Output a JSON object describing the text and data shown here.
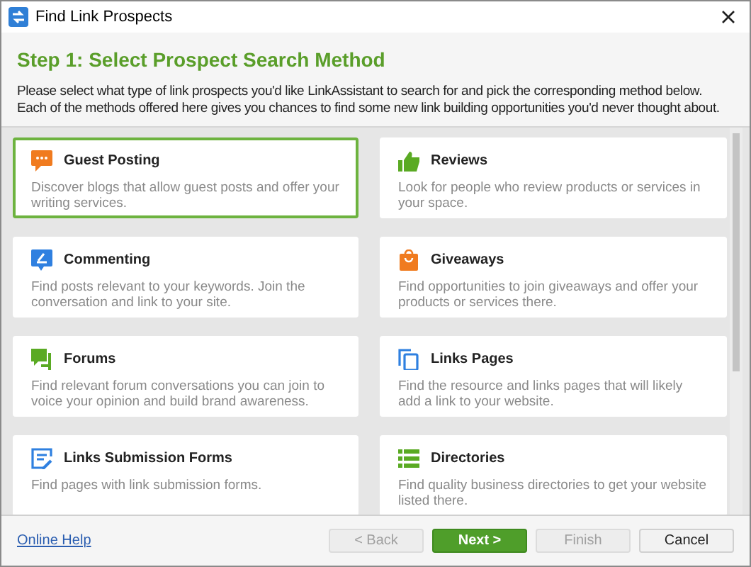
{
  "window": {
    "title": "Find Link Prospects"
  },
  "header": {
    "title": "Step 1: Select Prospect Search Method",
    "description": "Please select what type of link prospects you'd like LinkAssistant to search for and pick the corresponding method below. Each of the methods offered here gives you chances to find some new link building opportunities you'd never thought about."
  },
  "methods": [
    {
      "title": "Guest Posting",
      "description": "Discover blogs that allow guest posts and offer your writing services.",
      "kind": "chat",
      "selected": true
    },
    {
      "title": "Reviews",
      "description": "Look for people who review products or services in your space.",
      "kind": "thumb",
      "selected": false
    },
    {
      "title": "Commenting",
      "description": "Find posts relevant to your keywords. Join the conversation and link to your site.",
      "kind": "comment",
      "selected": false
    },
    {
      "title": "Giveaways",
      "description": "Find opportunities to join giveaways and offer your products or services there.",
      "kind": "bag",
      "selected": false
    },
    {
      "title": "Forums",
      "description": "Find relevant forum conversations you can join to voice your opinion and build brand awareness.",
      "kind": "forum",
      "selected": false
    },
    {
      "title": "Links Pages",
      "description": "Find the resource and links pages that will likely add a link to your website.",
      "kind": "pages",
      "selected": false
    },
    {
      "title": "Links Submission Forms",
      "description": "Find pages with link submission forms.",
      "kind": "form",
      "selected": false
    },
    {
      "title": "Directories",
      "description": "Find quality business directories to get your website listed there.",
      "kind": "list",
      "selected": false
    }
  ],
  "footer": {
    "help_link": "Online Help",
    "buttons": [
      {
        "label": "< Back",
        "kind": "default",
        "disabled": true
      },
      {
        "label": "Next >",
        "kind": "primary",
        "disabled": false
      },
      {
        "label": "Finish",
        "kind": "default",
        "disabled": true
      },
      {
        "label": "Cancel",
        "kind": "default",
        "disabled": false
      }
    ]
  }
}
